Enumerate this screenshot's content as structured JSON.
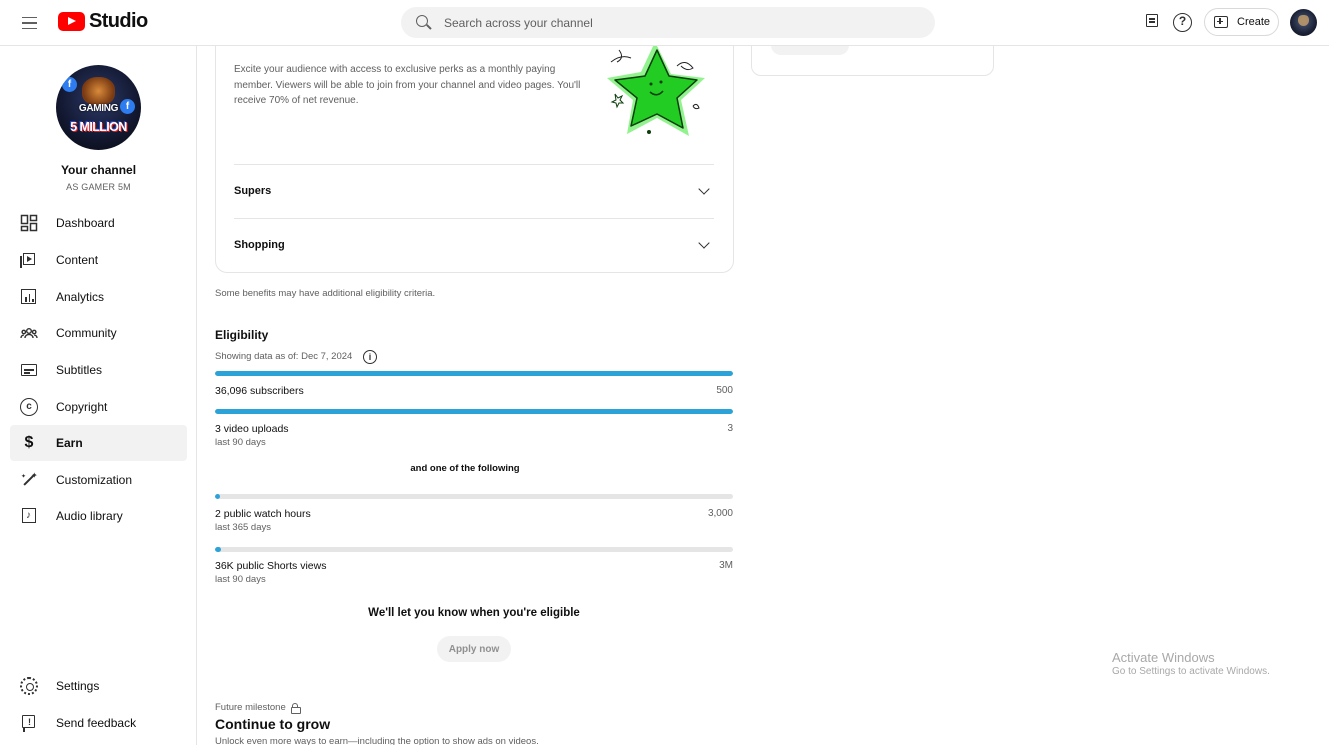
{
  "header": {
    "app_name": "Studio",
    "search_placeholder": "Search across your channel",
    "create_label": "Create"
  },
  "sidebar": {
    "channel_title": "Your channel",
    "channel_handle": "AS GAMER 5M",
    "avatar_text": {
      "name": "GAMING",
      "tagline": "5 MILLION"
    },
    "items": [
      {
        "label": "Dashboard",
        "icon": "dashboard-icon"
      },
      {
        "label": "Content",
        "icon": "content-icon"
      },
      {
        "label": "Analytics",
        "icon": "analytics-icon"
      },
      {
        "label": "Community",
        "icon": "community-icon"
      },
      {
        "label": "Subtitles",
        "icon": "subtitles-icon"
      },
      {
        "label": "Copyright",
        "icon": "copyright-icon"
      },
      {
        "label": "Earn",
        "icon": "dollar-icon",
        "active": true
      },
      {
        "label": "Customization",
        "icon": "magic-wand-icon"
      },
      {
        "label": "Audio library",
        "icon": "audio-library-icon"
      }
    ],
    "bottom_items": [
      {
        "label": "Settings",
        "icon": "gear-icon"
      },
      {
        "label": "Send feedback",
        "icon": "feedback-icon"
      }
    ]
  },
  "memberships_card": {
    "description": "Excite your audience with access to exclusive perks as a monthly paying member. Viewers will be able to join from your channel and video pages. You'll receive 70% of net revenue.",
    "accordions": [
      {
        "label": "Supers"
      },
      {
        "label": "Shopping"
      }
    ]
  },
  "eligibility": {
    "note": "Some benefits may have additional eligibility criteria.",
    "title": "Eligibility",
    "as_of": "Showing data as of: Dec 7, 2024",
    "required": [
      {
        "label": "36,096 subscribers",
        "sub": "",
        "target": "500",
        "progress": 1.0
      },
      {
        "label": "3 video uploads",
        "sub": "last 90 days",
        "target": "3",
        "progress": 1.0
      }
    ],
    "one_of_label": "and one of the following",
    "one_of": [
      {
        "label": "2 public watch hours",
        "sub": "last 365 days",
        "target": "3,000",
        "progress": 0.0007
      },
      {
        "label": "36K public Shorts views",
        "sub": "last 90 days",
        "target": "3M",
        "progress": 0.012
      }
    ],
    "notify_text": "We'll let you know when you're eligible",
    "apply_label": "Apply now"
  },
  "future": {
    "label": "Future milestone",
    "title": "Continue to grow",
    "description": "Unlock even more ways to earn—including the option to show ads on videos."
  },
  "watermark": {
    "line1": "Activate Windows",
    "line2": "Go to Settings to activate Windows."
  },
  "colors": {
    "accent": "#2ba3d9",
    "brand": "#ff0000",
    "star": "#22cc22"
  }
}
